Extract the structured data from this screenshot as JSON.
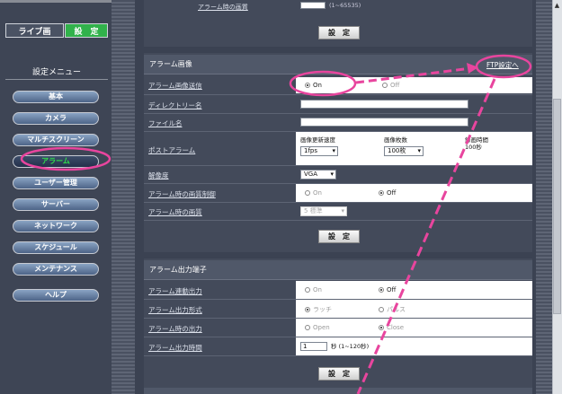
{
  "nav": {
    "live_tab": "ライブ画",
    "settings_tab": "設　定",
    "menu_title": "設定メニュー",
    "items": [
      "基本",
      "カメラ",
      "マルチスクリーン",
      "アラーム",
      "ユーザー管理",
      "サーバー",
      "ネットワーク",
      "スケジュール",
      "メンテナンス",
      "ヘルプ"
    ],
    "active_index": 3
  },
  "top": {
    "partial_label": "アラーム時の画質",
    "partial_value": "(1~65535)",
    "set_button": "設　定"
  },
  "alarm_image": {
    "header": "アラーム画像",
    "ftp_link": "FTP設定へ",
    "rows": {
      "send_label": "アラーム画像送信",
      "send_on": "On",
      "send_off": "Off",
      "dir_label": "ディレクトリー名",
      "dir_value": "",
      "file_label": "ファイル名",
      "file_value": "",
      "post_label": "ポストアラーム",
      "rate_title": "画像更新速度",
      "rate_value": "1fps",
      "count_title": "画像枚数",
      "count_value": "100枚",
      "duration_title": "録画時間",
      "duration_value": "100秒",
      "res_label": "解像度",
      "res_value": "VGA",
      "qctrl_label": "アラーム時の画質制御",
      "qctrl_on": "On",
      "qctrl_off": "Off",
      "quality_label": "アラーム時の画質",
      "quality_value": "5 標準"
    },
    "set_button": "設　定"
  },
  "alarm_output": {
    "header": "アラーム出力端子",
    "rows": {
      "link_label": "アラーム連動出力",
      "link_on": "On",
      "link_off": "Off",
      "format_label": "アラーム出力形式",
      "format_latch": "ラッチ",
      "format_pulse": "パルス",
      "out_label": "アラーム時の出力",
      "out_open": "Open",
      "out_close": "Close",
      "time_label": "アラーム出力時間",
      "time_value": "1",
      "time_unit": "秒 (1~120秒)"
    },
    "set_button": "設　定"
  },
  "colors": {
    "annotation": "#e8459e",
    "active_nav": "#2ee04a",
    "settings_tab": "#31b24b"
  }
}
